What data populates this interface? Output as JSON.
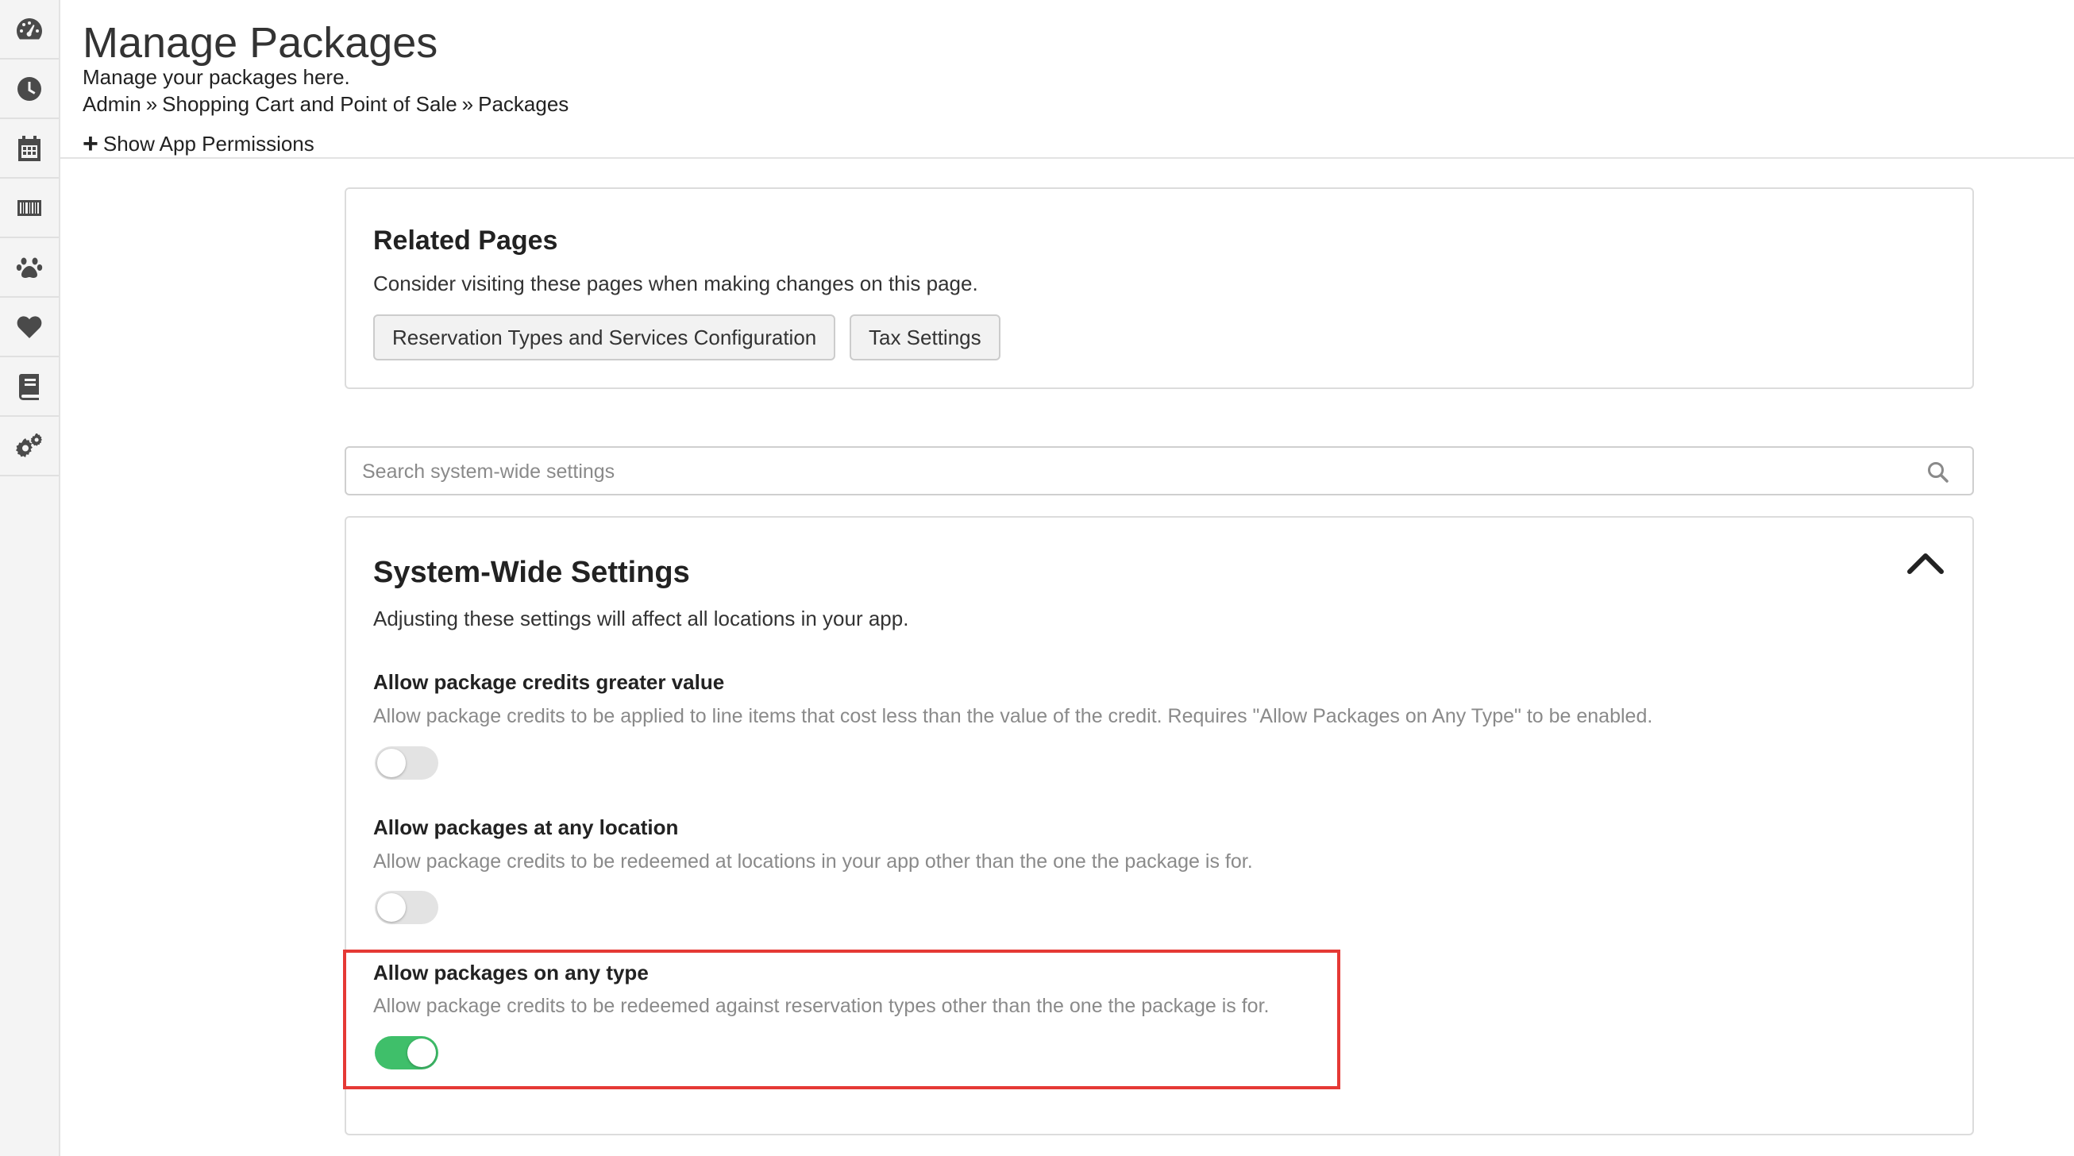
{
  "sidebar": {
    "items": [
      {
        "icon": "dashboard-icon"
      },
      {
        "icon": "clock-icon"
      },
      {
        "icon": "calendar-icon"
      },
      {
        "icon": "barcode-icon"
      },
      {
        "icon": "paw-icon"
      },
      {
        "icon": "heart-icon"
      },
      {
        "icon": "book-icon"
      },
      {
        "icon": "gears-icon"
      }
    ]
  },
  "header": {
    "title": "Manage Packages",
    "subtitle": "Manage your packages here.",
    "breadcrumb": [
      "Admin",
      "Shopping Cart and Point of Sale",
      "Packages"
    ],
    "breadcrumb_sep": "»",
    "permissions_label": "Show App Permissions"
  },
  "related": {
    "title": "Related Pages",
    "description": "Consider visiting these pages when making changes on this page.",
    "buttons": [
      "Reservation Types and Services Configuration",
      "Tax Settings"
    ]
  },
  "search": {
    "placeholder": "Search system-wide settings"
  },
  "settings": {
    "title": "System-Wide Settings",
    "description": "Adjusting these settings will affect all locations in your app.",
    "items": [
      {
        "title": "Allow package credits greater value",
        "description": "Allow package credits to be applied to line items that cost less than the value of the credit. Requires \"Allow Packages on Any Type\" to be enabled.",
        "enabled": false
      },
      {
        "title": "Allow packages at any location",
        "description": "Allow package credits to be redeemed at locations in your app other than the one the package is for.",
        "enabled": false
      },
      {
        "title": "Allow packages on any type",
        "description": "Allow package credits to be redeemed against reservation types other than the one the package is for.",
        "enabled": true
      }
    ]
  },
  "colors": {
    "toggle_on": "#3fbf6a",
    "toggle_off": "#e3e3e3",
    "highlight": "#e53935"
  }
}
